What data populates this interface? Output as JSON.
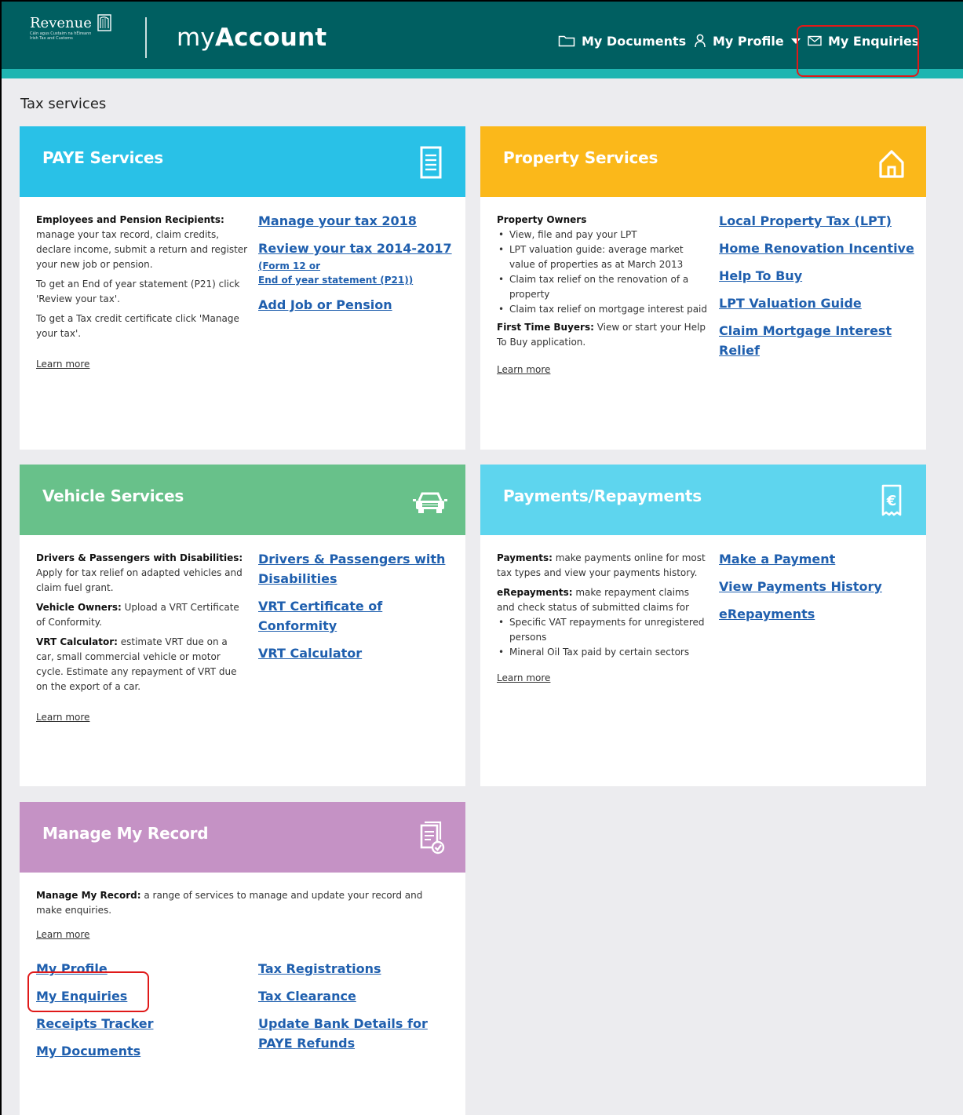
{
  "header": {
    "logo_title": "Revenue",
    "logo_subtitle": "Cáin agus Custaim na hÉireann Irish Tax and Customs",
    "brand_prefix": "my",
    "brand_bold": "Account",
    "nav": {
      "documents": "My Documents",
      "profile": "My Profile",
      "enquiries": "My Enquiries"
    }
  },
  "page_title": "Tax services",
  "cards": {
    "paye": {
      "title": "PAYE Services",
      "color": "#29c1e7",
      "desc_lead_bold": "Employees and Pension Recipients:",
      "desc_lead": " manage your tax record, claim credits, declare income, submit a return and register your new job or pension.",
      "desc_2": "To get an End of year statement (P21) click 'Review your tax'.",
      "desc_3": "To get a Tax credit certificate click 'Manage your tax'.",
      "learn_more": "Learn more",
      "link_1": "Manage your tax 2018",
      "link_2": "Review your tax 2014-2017",
      "link_2a": "(Form 12 or",
      "link_2b": "End of year statement (P21))",
      "link_3": "Add Job or Pension"
    },
    "property": {
      "title": "Property Services",
      "color": "#fbb81a",
      "desc_head": "Property Owners",
      "bullets": [
        "View, file and pay your LPT",
        "LPT valuation guide: average market value of properties as at March 2013",
        "Claim tax relief on the renovation of a property",
        "Claim tax relief on mortgage interest paid"
      ],
      "ftb_bold": "First Time Buyers:",
      "ftb_text": " View or start your Help To Buy application.",
      "learn_more": "Learn more",
      "link_1": "Local Property Tax (LPT)",
      "link_2": "Home Renovation Incentive",
      "link_3": "Help To Buy",
      "link_4": "LPT Valuation Guide",
      "link_5": "Claim Mortgage Interest Relief"
    },
    "vehicle": {
      "title": "Vehicle Services",
      "color": "#68c18a",
      "p1_bold": "Drivers & Passengers with Disabilities:",
      "p1_text": " Apply for tax relief on adapted vehicles and claim fuel grant.",
      "p2_bold": "Vehicle Owners:",
      "p2_text": " Upload a VRT Certificate of Conformity.",
      "p3_bold": "VRT Calculator:",
      "p3_text": " estimate VRT due on a car, small commercial vehicle or motor cycle. Estimate any repayment of VRT due on the export of a car.",
      "learn_more": "Learn more",
      "link_1": "Drivers & Passengers with Disabilities",
      "link_2": "VRT Certificate of Conformity",
      "link_3": "VRT Calculator"
    },
    "payments": {
      "title": "Payments/Repayments",
      "color": "#5ed5ee",
      "p1_bold": "Payments:",
      "p1_text": " make payments online for most tax types and view your payments history.",
      "p2_bold": "eRepayments:",
      "p2_text": " make repayment claims and check status of submitted claims for",
      "bullets": [
        "Specific VAT repayments for unregistered persons",
        "Mineral Oil Tax paid by certain sectors"
      ],
      "learn_more": "Learn more",
      "link_1": "Make a Payment",
      "link_2": "View Payments History",
      "link_3": "eRepayments"
    },
    "record": {
      "title": "Manage My Record",
      "color": "#c592c5",
      "desc_bold": "Manage My Record:",
      "desc_text": " a range of services to manage and update your record and make enquiries.",
      "learn_more": "Learn more",
      "left_links": [
        "My Profile",
        "My Enquiries",
        "Receipts Tracker",
        "My Documents"
      ],
      "right_links": [
        "Tax Registrations",
        "Tax Clearance",
        "Update Bank Details for PAYE Refunds"
      ]
    }
  },
  "highlight_color": "#e01919"
}
